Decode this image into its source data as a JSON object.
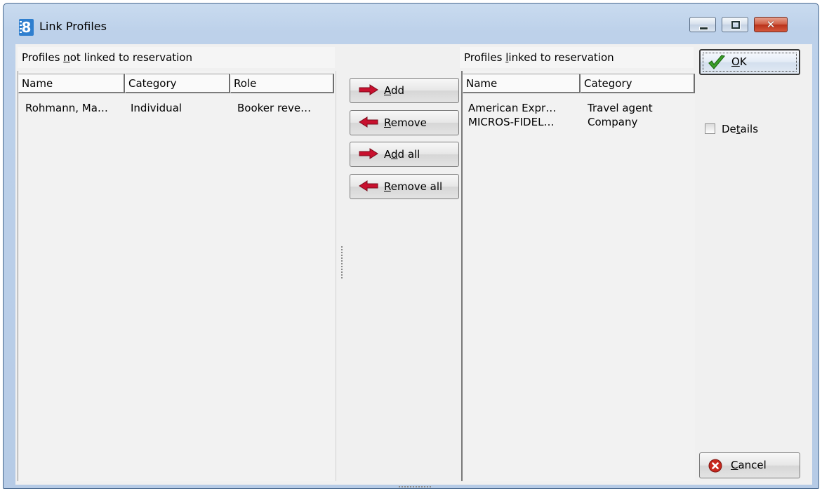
{
  "window": {
    "title": "Link Profiles",
    "icon_glyph": "8"
  },
  "left_panel": {
    "header_parts": [
      "Profiles ",
      "n",
      "ot linked to reservation"
    ],
    "columns": [
      "Name",
      "Category",
      "Role"
    ],
    "rows": [
      {
        "name": "Rohmann, Ma…",
        "category": "Individual",
        "role": "Booker reve…"
      }
    ]
  },
  "right_panel": {
    "header_parts": [
      "Profiles ",
      "l",
      "inked to reservation"
    ],
    "columns": [
      "Name",
      "Category"
    ],
    "rows": [
      {
        "name": "American Expr…",
        "category": "Travel agent"
      },
      {
        "name": "MICROS-FIDEL…",
        "category": "Company"
      }
    ]
  },
  "buttons": {
    "add": [
      "",
      "A",
      "dd"
    ],
    "remove": [
      "",
      "R",
      "emove"
    ],
    "add_all": [
      "A",
      "d",
      "d all"
    ],
    "remove_all": [
      "",
      "R",
      "emove all"
    ],
    "ok": [
      "",
      "O",
      "K"
    ],
    "cancel": [
      "",
      "C",
      "ancel"
    ]
  },
  "details": {
    "label_parts": [
      "De",
      "t",
      "ails"
    ],
    "checked": false
  },
  "colors": {
    "arrow": "#c8102e",
    "ok_check": "#3aa02a",
    "cancel_icon": "#c8281e",
    "app_icon": "#2f7fcf"
  }
}
